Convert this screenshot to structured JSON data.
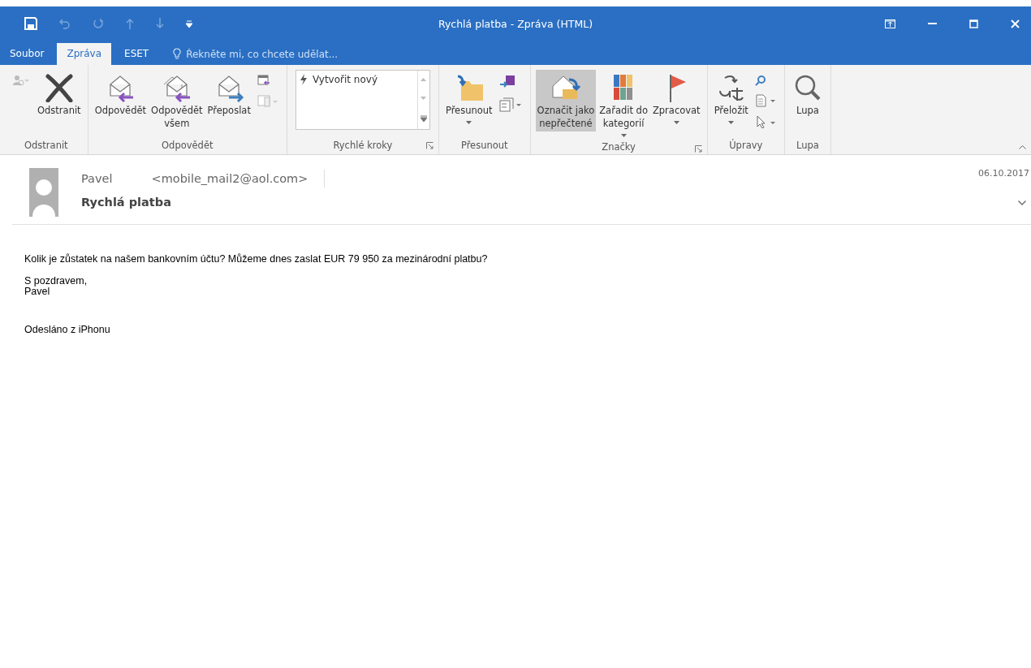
{
  "window": {
    "title": "Rychlá platba - Zpráva (HTML)"
  },
  "tabs": [
    {
      "label": "Soubor",
      "selected": false
    },
    {
      "label": "Zpráva",
      "selected": true
    },
    {
      "label": "ESET",
      "selected": false
    }
  ],
  "tell_me": {
    "placeholder": "Řekněte mi, co chcete udělat..."
  },
  "ribbon": {
    "groups": [
      {
        "label": "Odstranit",
        "launcher": false,
        "buttons": [
          {
            "label": "Odstranit",
            "dropdown": false,
            "highlighted": false
          }
        ]
      },
      {
        "label": "Odpovědět",
        "launcher": false,
        "buttons": [
          {
            "label": "Odpovědět",
            "dropdown": false,
            "highlighted": false
          },
          {
            "label": "Odpovědět\nvšem",
            "dropdown": false,
            "highlighted": false
          },
          {
            "label": "Přeposlat",
            "dropdown": false,
            "highlighted": false
          }
        ]
      },
      {
        "label": "Rychlé kroky",
        "launcher": true,
        "gallery": [
          "Vytvořit nový"
        ]
      },
      {
        "label": "Přesunout",
        "launcher": false,
        "buttons": [
          {
            "label": "Přesunout",
            "dropdown": true,
            "highlighted": false
          }
        ]
      },
      {
        "label": "Značky",
        "launcher": true,
        "buttons": [
          {
            "label": "Označit jako\nnepřečtené",
            "dropdown": false,
            "highlighted": true
          },
          {
            "label": "Zařadit do\nkategorií",
            "dropdown": true,
            "highlighted": false
          },
          {
            "label": "Zpracovat",
            "dropdown": true,
            "highlighted": false
          }
        ]
      },
      {
        "label": "Úpravy",
        "launcher": false,
        "buttons": [
          {
            "label": "Přeložit",
            "dropdown": true,
            "highlighted": false
          }
        ]
      },
      {
        "label": "Lupa",
        "launcher": false,
        "buttons": [
          {
            "label": "Lupa",
            "dropdown": false,
            "highlighted": false
          }
        ]
      }
    ]
  },
  "message": {
    "sender_name": "Pavel",
    "sender_email": "<mobile_mail2@aol.com>",
    "date": "06.10.2017",
    "subject": "Rychlá platba",
    "body": [
      [
        "Kolik je zůstatek na našem bankovním účtu? Můžeme dnes zaslat EUR 79 950 za mezinárodní platbu?"
      ],
      [
        "S pozdravem,",
        "Pavel"
      ],
      [
        "Odesláno z iPhonu"
      ]
    ]
  }
}
